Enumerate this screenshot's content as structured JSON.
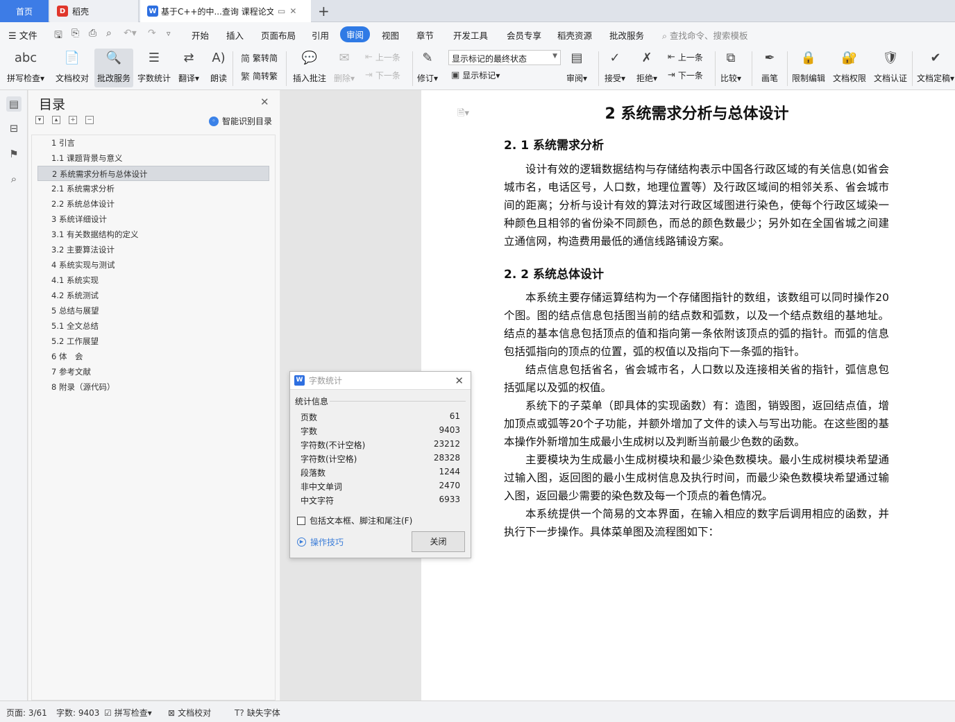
{
  "tabs": {
    "home": "首页",
    "daoke": "稻壳",
    "doc": "基于C++的中...查询 课程论文",
    "doc_icon": "W",
    "daoke_icon": "D"
  },
  "menu": {
    "file": "文件",
    "items": [
      "开始",
      "插入",
      "页面布局",
      "引用",
      "审阅",
      "视图",
      "章节",
      "开发工具",
      "会员专享",
      "稻壳资源",
      "批改服务"
    ],
    "active": "审阅",
    "search": "查找命令、搜索模板"
  },
  "ribbon": {
    "spell": "拼写检查",
    "proofread": "文档校对",
    "correction": "批改服务",
    "wordcount": "字数统计",
    "translate": "翻译",
    "read": "朗读",
    "trad": "繁转简",
    "simp": "简转繁",
    "insert_comment": "插入批注",
    "delete": "删除",
    "prev_comment": "上一条",
    "next_comment": "下一条",
    "revise": "修订",
    "markup_state": "显示标记的最终状态",
    "show_markup": "显示标记",
    "review": "审阅",
    "accept": "接受",
    "reject": "拒绝",
    "prev_change": "上一条",
    "next_change": "下一条",
    "compare": "比较",
    "pen": "画笔",
    "restrict": "限制编辑",
    "permission": "文档权限",
    "certify": "文档认证",
    "finalize": "文档定稿"
  },
  "nav": {
    "title": "目录",
    "smart": "智能识别目录",
    "items": [
      "1 引言",
      "1.1 课题背景与意义",
      "2 系统需求分析与总体设计",
      "2.1 系统需求分析",
      "2.2 系统总体设计",
      "3 系统详细设计",
      "3.1 有关数据结构的定义",
      "3.2 主要算法设计",
      "4 系统实现与测试",
      "4.1 系统实现",
      "4.2 系统测试",
      "5 总结与展望",
      "5.1 全文总结",
      "5.2 工作展望",
      "6 体　会",
      "7 参考文献",
      "8 附录（源代码）"
    ],
    "selected_index": 2
  },
  "document": {
    "h1": "2 系统需求分析与总体设计",
    "h2_1": "2. 1 系统需求分析",
    "p1": "设计有效的逻辑数据结构与存储结构表示中国各行政区域的有关信息(如省会城市名，电话区号，人口数，地理位置等）及行政区域间的相邻关系、省会城市间的距离；分析与设计有效的算法对行政区域图进行染色，使每个行政区域染一种颜色且相邻的省份染不同颜色，而总的颜色数最少；另外如在全国省城之间建立通信网，构造费用最低的通信线路铺设方案。",
    "h2_2": "2. 2 系统总体设计",
    "p2": "本系统主要存储运算结构为一个存储图指针的数组，该数组可以同时操作20个图。图的结点信息包括图当前的结点数和弧数，以及一个结点数组的基地址。结点的基本信息包括顶点的值和指向第一条依附该顶点的弧的指针。而弧的信息包括弧指向的顶点的位置，弧的权值以及指向下一条弧的指针。",
    "p3": "结点信息包括省名，省会城市名，人口数以及连接相关省的指针，弧信息包括弧尾以及弧的权值。",
    "p4": "系统下的子菜单（即具体的实现函数）有：造图，销毁图，返回结点值，增加顶点或弧等20个子功能，并额外增加了文件的读入与写出功能。在这些图的基本操作外新增加生成最小生成树以及判断当前最少色数的函数。",
    "p5": "主要模块为生成最小生成树模块和最少染色数模块。最小生成树模块希望通过输入图，返回图的最小生成树信息及执行时间，而最少染色数模块希望通过输入图，返回最少需要的染色数及每一个顶点的着色情况。",
    "p6": "本系统提供一个简易的文本界面，在输入相应的数字后调用相应的函数，并执行下一步操作。具体菜单图及流程图如下："
  },
  "wordcount": {
    "title": "字数统计",
    "group": "统计信息",
    "rows": [
      {
        "label": "页数",
        "value": "61"
      },
      {
        "label": "字数",
        "value": "9403"
      },
      {
        "label": "字符数(不计空格)",
        "value": "23212"
      },
      {
        "label": "字符数(计空格)",
        "value": "28328"
      },
      {
        "label": "段落数",
        "value": "1244"
      },
      {
        "label": "非中文单词",
        "value": "2470"
      },
      {
        "label": "中文字符",
        "value": "6933"
      }
    ],
    "include": "包括文本框、脚注和尾注(F)",
    "tips": "操作技巧",
    "close": "关闭"
  },
  "status": {
    "page": "页面: 3/61",
    "words": "字数: 9403",
    "spell": "拼写检查",
    "proofread": "文档校对",
    "missing_font": "缺失字体"
  },
  "colors": {
    "accent": "#2f7ae5",
    "home_tab": "#3d7ce6"
  }
}
